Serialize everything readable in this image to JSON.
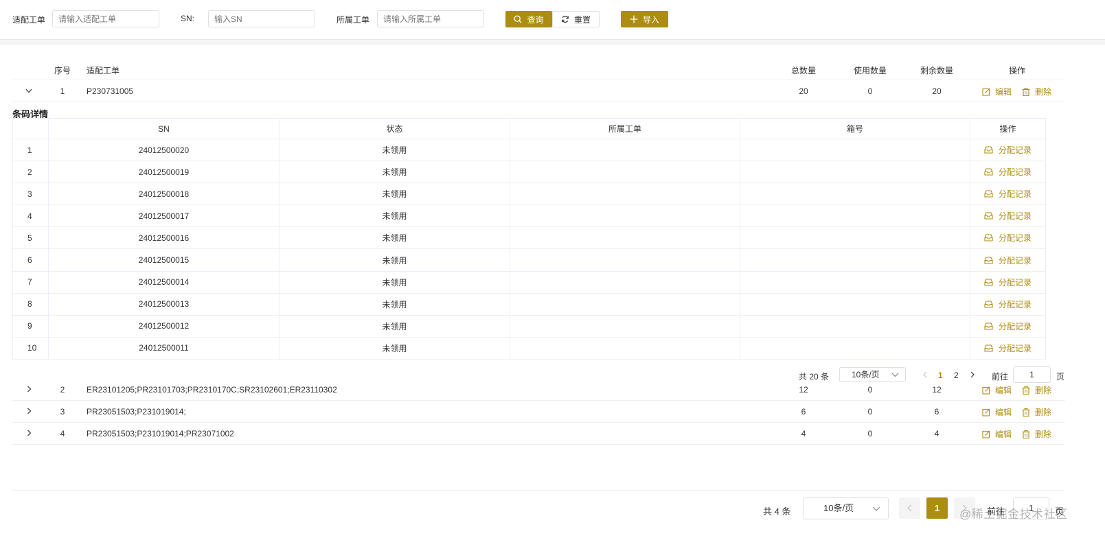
{
  "filters": {
    "work_order_label": "适配工单",
    "work_order_placeholder": "请输入适配工单",
    "sn_label": "SN:",
    "sn_placeholder": "输入SN",
    "owner_order_label": "所属工单",
    "owner_order_placeholder": "请输入所属工单",
    "query_label": "查询",
    "reset_label": "重置",
    "import_label": "导入"
  },
  "main_table": {
    "headers": {
      "index": "序号",
      "work_order": "适配工单",
      "total": "总数量",
      "used": "使用数量",
      "remaining": "剩余数量",
      "actions": "操作"
    },
    "edit_label": "编辑",
    "delete_label": "删除",
    "rows": [
      {
        "index": "1",
        "work_order": "P230731005",
        "total": "20",
        "used": "0",
        "remaining": "20"
      },
      {
        "index": "2",
        "work_order": "ER23101205;PR23101703;PR2310170C;SR23102601;ER23110302",
        "total": "12",
        "used": "0",
        "remaining": "12"
      },
      {
        "index": "3",
        "work_order": "PR23051503;P231019014;",
        "total": "6",
        "used": "0",
        "remaining": "6"
      },
      {
        "index": "4",
        "work_order": "PR23051503;P231019014;PR23071002",
        "total": "4",
        "used": "0",
        "remaining": "4"
      }
    ]
  },
  "detail": {
    "title": "条码详情",
    "headers": {
      "sn": "SN",
      "status": "状态",
      "owner_order": "所属工单",
      "box_no": "箱号",
      "actions": "操作"
    },
    "action_label": "分配记录",
    "rows": [
      {
        "index": "1",
        "sn": "24012500020",
        "status": "未领用",
        "owner_order": "",
        "box_no": ""
      },
      {
        "index": "2",
        "sn": "24012500019",
        "status": "未领用",
        "owner_order": "",
        "box_no": ""
      },
      {
        "index": "3",
        "sn": "24012500018",
        "status": "未领用",
        "owner_order": "",
        "box_no": ""
      },
      {
        "index": "4",
        "sn": "24012500017",
        "status": "未领用",
        "owner_order": "",
        "box_no": ""
      },
      {
        "index": "5",
        "sn": "24012500016",
        "status": "未领用",
        "owner_order": "",
        "box_no": ""
      },
      {
        "index": "6",
        "sn": "24012500015",
        "status": "未领用",
        "owner_order": "",
        "box_no": ""
      },
      {
        "index": "7",
        "sn": "24012500014",
        "status": "未领用",
        "owner_order": "",
        "box_no": ""
      },
      {
        "index": "8",
        "sn": "24012500013",
        "status": "未领用",
        "owner_order": "",
        "box_no": ""
      },
      {
        "index": "9",
        "sn": "24012500012",
        "status": "未领用",
        "owner_order": "",
        "box_no": ""
      },
      {
        "index": "10",
        "sn": "24012500011",
        "status": "未领用",
        "owner_order": "",
        "box_no": ""
      }
    ],
    "pager": {
      "total": "共 20 条",
      "page_size": "10条/页",
      "pages": [
        "1",
        "2"
      ],
      "current": "1",
      "goto": "前往",
      "goto_value": "1",
      "unit": "页"
    }
  },
  "pager": {
    "total": "共 4 条",
    "page_size": "10条/页",
    "current": "1",
    "goto": "前往",
    "goto_value": "1",
    "unit": "页"
  },
  "watermark": "@稀土掘金技术社区",
  "colors": {
    "accent": "#ad8d0f",
    "border": "#ebeef5"
  }
}
